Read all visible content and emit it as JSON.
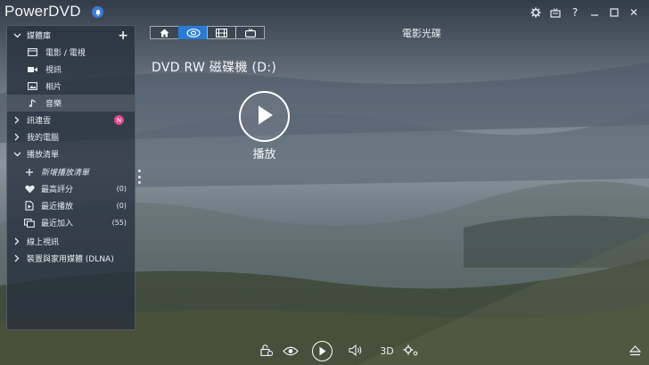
{
  "app": {
    "title": "PowerDVD"
  },
  "window_controls": [
    "settings-icon",
    "tv-mode-icon",
    "help-icon",
    "minimize-icon",
    "maximize-icon",
    "close-icon"
  ],
  "window_labels": {
    "help": "?",
    "close": "✕"
  },
  "sidebar": {
    "media_library": {
      "label": "媒體庫",
      "add": "+"
    },
    "library_items": [
      {
        "label": "電影 / 電視",
        "icon": "movie-tv-icon"
      },
      {
        "label": "視訊",
        "icon": "video-camera-icon"
      },
      {
        "label": "相片",
        "icon": "photo-icon"
      },
      {
        "label": "音樂",
        "icon": "music-note-icon",
        "selected": true
      }
    ],
    "cloud": {
      "label": "訊連雲",
      "badge": "N"
    },
    "my_computer": {
      "label": "我的電腦"
    },
    "playlist": {
      "label": "播放清單"
    },
    "playlist_items": [
      {
        "label": "新增播放清單",
        "icon": "add-icon",
        "count": ""
      },
      {
        "label": "最高評分",
        "icon": "heart-icon",
        "count": "(0)"
      },
      {
        "label": "最近播放",
        "icon": "recent-play-icon",
        "count": "(0)"
      },
      {
        "label": "最近加入",
        "icon": "recent-add-icon",
        "count": "(55)"
      }
    ],
    "online_video": {
      "label": "線上視訊"
    },
    "devices": {
      "label": "裝置與家用媒體 (DLNA)"
    }
  },
  "tabs": [
    {
      "icon": "home-icon"
    },
    {
      "icon": "disc-icon",
      "active": true
    },
    {
      "icon": "film-icon"
    },
    {
      "icon": "tv-icon"
    }
  ],
  "main": {
    "section_title": "電影光碟",
    "disc_title": "DVD RW 磁碟機 (D:)",
    "play_label": "播放"
  },
  "bottom": {
    "three_d": "3D"
  },
  "colors": {
    "accent": "#2a7bd3",
    "badge": "#e0498a"
  }
}
